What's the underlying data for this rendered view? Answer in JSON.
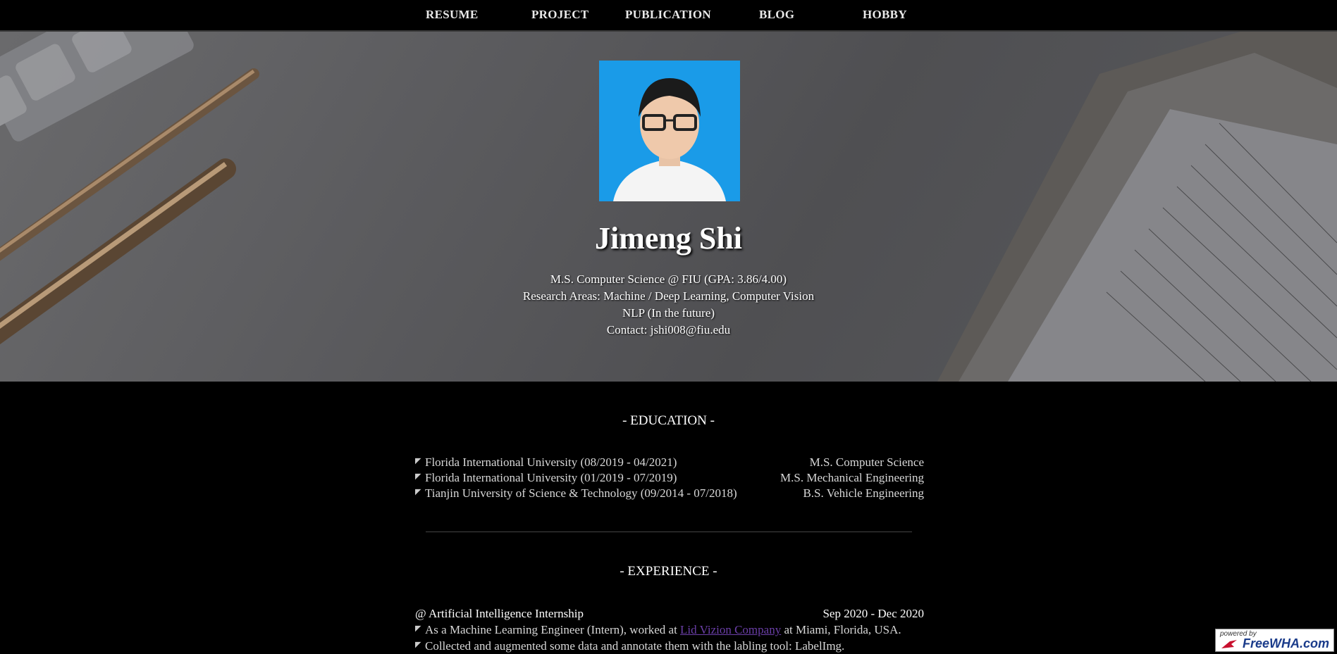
{
  "nav": {
    "items": [
      {
        "label": "RESUME"
      },
      {
        "label": "PROJECT"
      },
      {
        "label": "PUBLICATION"
      },
      {
        "label": "BLOG"
      },
      {
        "label": "HOBBY"
      }
    ]
  },
  "profile": {
    "name": "Jimeng Shi",
    "lines": [
      "M.S. Computer Science @ FIU (GPA: 3.86/4.00)",
      "Research Areas: Machine / Deep Learning, Computer Vision",
      "NLP (In the future)",
      "Contact: jshi008@fiu.edu"
    ]
  },
  "education": {
    "title": "- EDUCATION -",
    "items": [
      {
        "school": "Florida International University (08/2019 - 04/2021)",
        "degree": "M.S. Computer Science"
      },
      {
        "school": "Florida International University (01/2019 - 07/2019)",
        "degree": "M.S. Mechanical Engineering"
      },
      {
        "school": "Tianjin University of Science & Technology (09/2014 - 07/2018)",
        "degree": "B.S. Vehicle Engineering"
      }
    ]
  },
  "experience": {
    "title": "- EXPERIENCE -",
    "job_title": "@ Artificial Intelligence Internship",
    "job_dates": "Sep 2020 - Dec 2020",
    "line1_pre": "As a Machine Learning Engineer (Intern), worked at ",
    "line1_link": "Lid Vizion Company",
    "line1_post": " at Miami, Florida, USA.",
    "line2": "Collected and augmented some data and annotate them with the labling tool: LabelImg."
  },
  "badge": {
    "small": "powered by",
    "big": "FreeWHA.com"
  },
  "colors": {
    "photo_bg": "#1a9be8",
    "link": "#6b3fa8"
  }
}
